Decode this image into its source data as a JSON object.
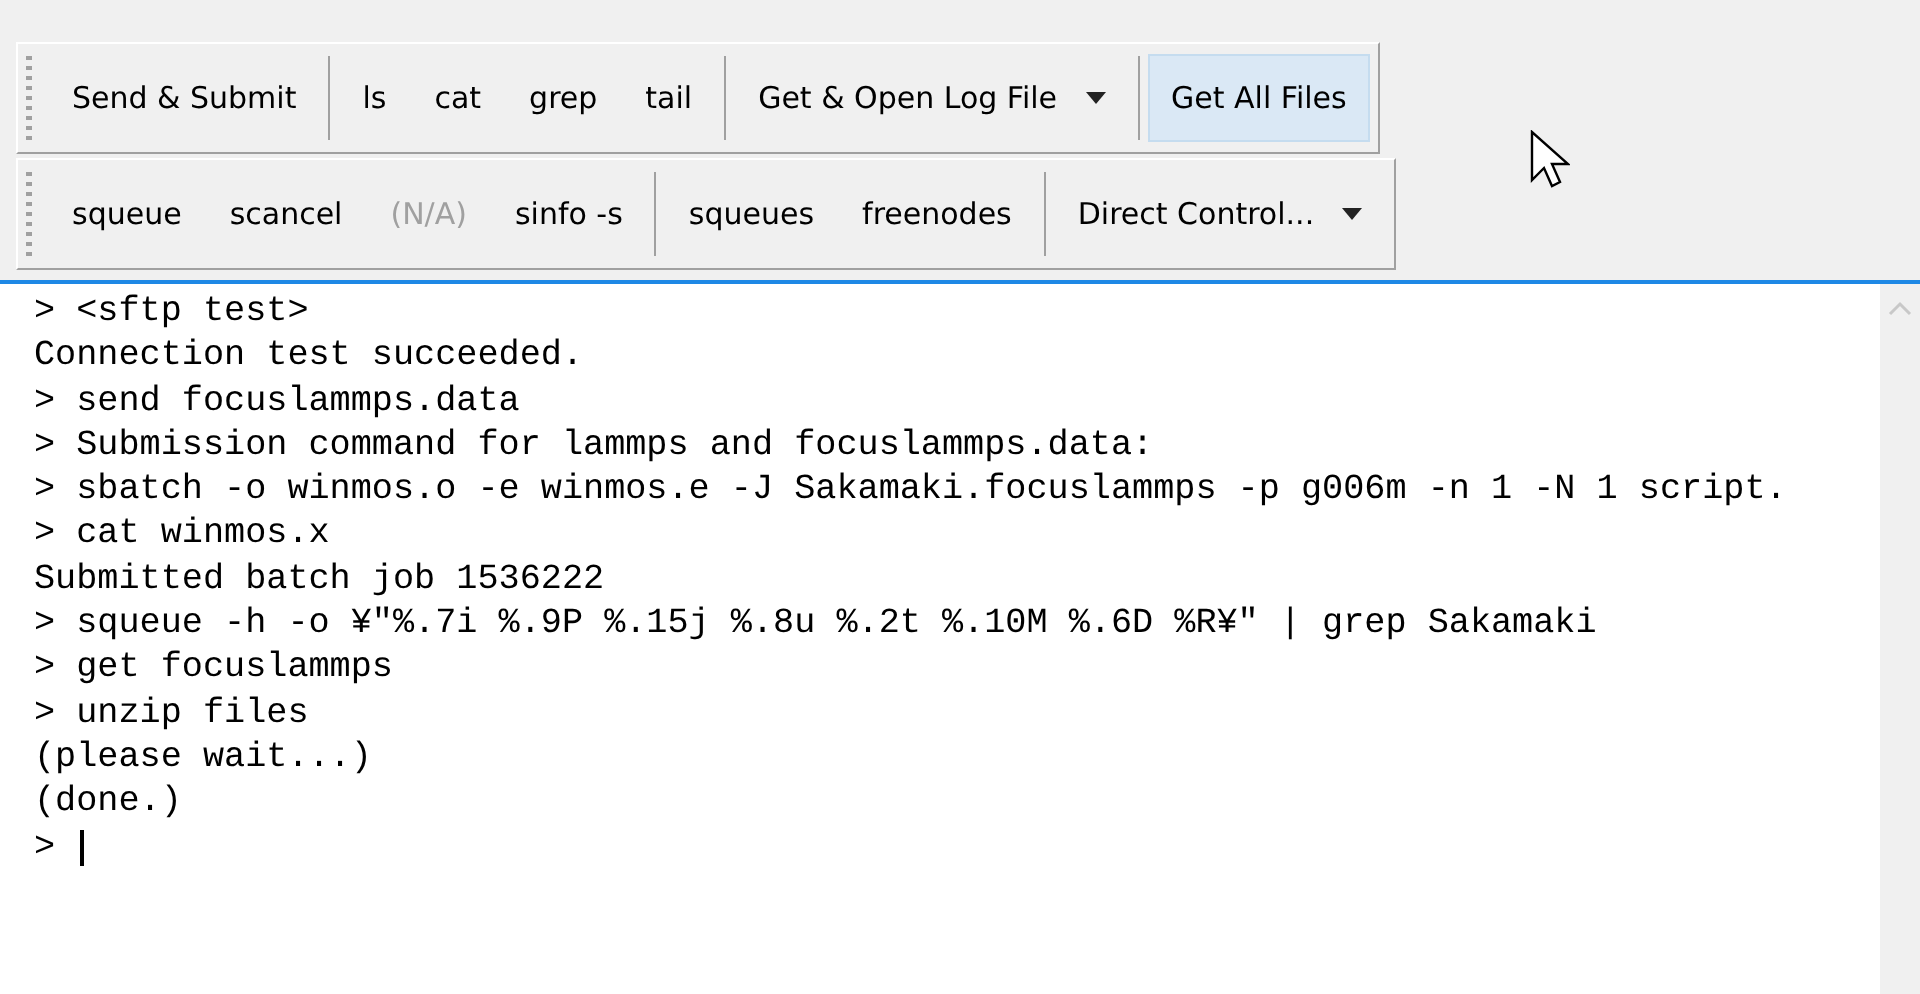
{
  "toolbars": [
    {
      "items": [
        {
          "kind": "button",
          "label": "Send & Submit",
          "disabled": false,
          "hovered": false
        },
        {
          "kind": "separator"
        },
        {
          "kind": "button",
          "label": "ls",
          "disabled": false,
          "hovered": false
        },
        {
          "kind": "button",
          "label": "cat",
          "disabled": false,
          "hovered": false
        },
        {
          "kind": "button",
          "label": "grep",
          "disabled": false,
          "hovered": false
        },
        {
          "kind": "button",
          "label": "tail",
          "disabled": false,
          "hovered": false
        },
        {
          "kind": "separator"
        },
        {
          "kind": "dropdown",
          "label": "Get & Open Log File",
          "disabled": false,
          "hovered": false
        },
        {
          "kind": "separator"
        },
        {
          "kind": "button",
          "label": "Get All Files",
          "disabled": false,
          "hovered": true
        }
      ]
    },
    {
      "items": [
        {
          "kind": "button",
          "label": "squeue",
          "disabled": false,
          "hovered": false
        },
        {
          "kind": "button",
          "label": "scancel",
          "disabled": false,
          "hovered": false
        },
        {
          "kind": "button",
          "label": "(N/A)",
          "disabled": true,
          "hovered": false
        },
        {
          "kind": "button",
          "label": "sinfo -s",
          "disabled": false,
          "hovered": false
        },
        {
          "kind": "separator"
        },
        {
          "kind": "button",
          "label": "squeues",
          "disabled": false,
          "hovered": false
        },
        {
          "kind": "button",
          "label": "freenodes",
          "disabled": false,
          "hovered": false
        },
        {
          "kind": "separator"
        },
        {
          "kind": "dropdown",
          "label": "Direct Control...",
          "disabled": false,
          "hovered": false
        }
      ]
    }
  ],
  "console": {
    "lines": [
      "> <sftp test>",
      "Connection test succeeded.",
      "> send focuslammps.data",
      "> Submission command for lammps and focuslammps.data:",
      "> sbatch -o winmos.o -e winmos.e -J Sakamaki.focuslammps -p g006m -n 1 -N 1 script.",
      "> cat winmos.x",
      "Submitted batch job 1536222",
      "> squeue -h -o ¥\"%.7i %.9P %.15j %.8u %.2t %.10M %.6D %R¥\" | grep Sakamaki",
      "> get focuslammps",
      "> unzip files",
      "(please wait...)",
      "(done.)",
      "> "
    ]
  }
}
